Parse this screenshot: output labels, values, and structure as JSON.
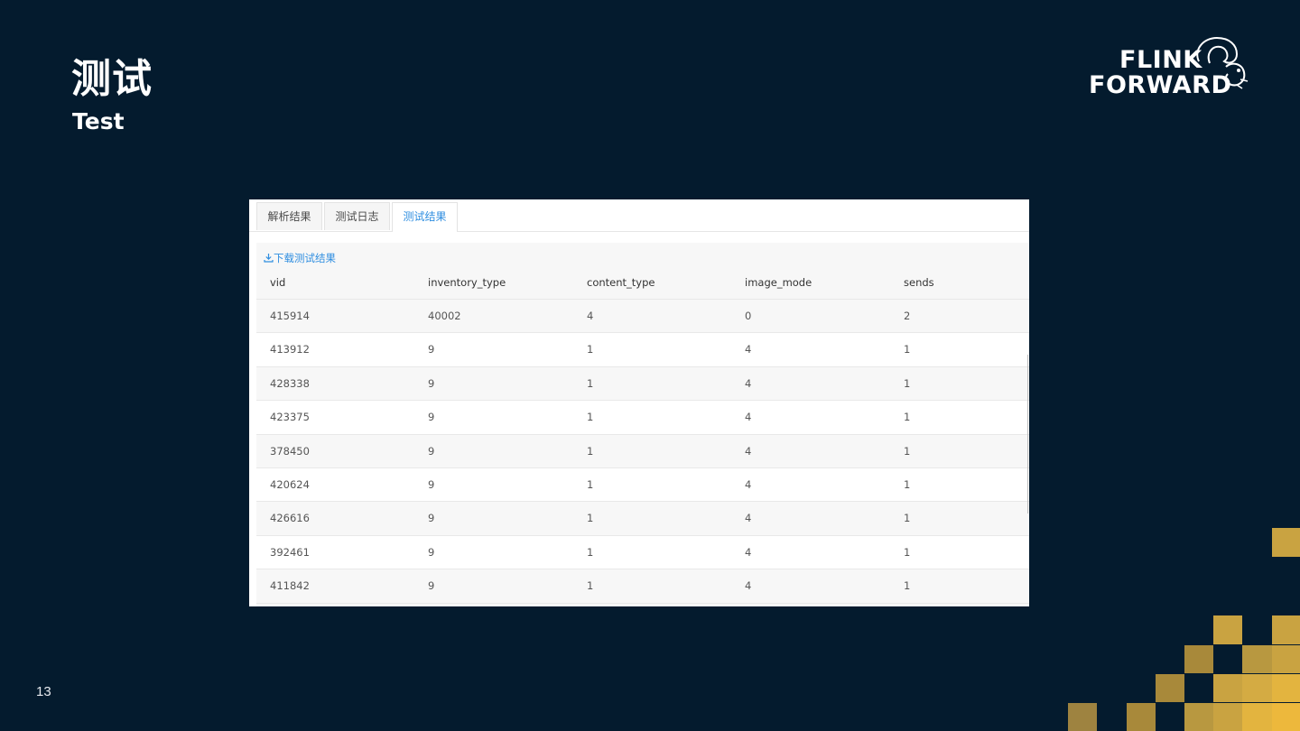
{
  "slide": {
    "title": "测试",
    "subtitle": "Test",
    "page_number": "13"
  },
  "logo": {
    "line1": "FLINK",
    "line2": "FORWARD",
    "icon": "squirrel-icon"
  },
  "tabs": [
    {
      "label": "解析结果",
      "active": false
    },
    {
      "label": "测试日志",
      "active": false
    },
    {
      "label": "测试结果",
      "active": true
    }
  ],
  "download": {
    "icon": "download-icon",
    "label": "下载测试结果"
  },
  "table": {
    "columns": [
      "vid",
      "inventory_type",
      "content_type",
      "image_mode",
      "sends"
    ],
    "rows": [
      [
        "415914",
        "40002",
        "4",
        "0",
        "2"
      ],
      [
        "413912",
        "9",
        "1",
        "4",
        "1"
      ],
      [
        "428338",
        "9",
        "1",
        "4",
        "1"
      ],
      [
        "423375",
        "9",
        "1",
        "4",
        "1"
      ],
      [
        "378450",
        "9",
        "1",
        "4",
        "1"
      ],
      [
        "420624",
        "9",
        "1",
        "4",
        "1"
      ],
      [
        "426616",
        "9",
        "1",
        "4",
        "1"
      ],
      [
        "392461",
        "9",
        "1",
        "4",
        "1"
      ],
      [
        "411842",
        "9",
        "1",
        "4",
        "1"
      ]
    ]
  },
  "colors": {
    "background": "#041b2e",
    "accent_blue": "#2f8ee0",
    "gold": "#c9a341"
  }
}
